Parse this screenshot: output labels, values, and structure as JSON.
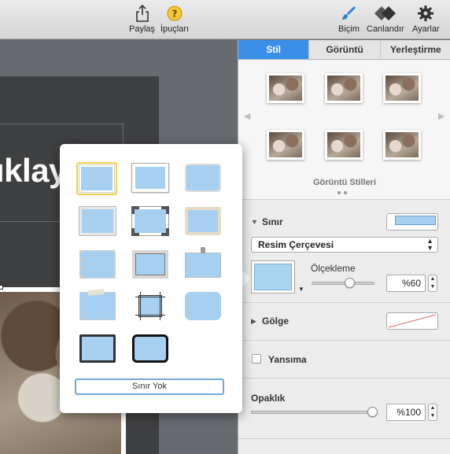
{
  "toolbar": {
    "share_label": "Paylaş",
    "tips_label": "İpuçları",
    "format_label": "Biçim",
    "animate_label": "Canlandır",
    "settings_label": "Ayarlar"
  },
  "slide": {
    "title_fragment": "ıklayın"
  },
  "inspector": {
    "tabs": [
      "Stil",
      "Görüntü",
      "Yerleştirme"
    ],
    "active_tab": "Stil",
    "styles_label": "Görüntü Stilleri",
    "border": {
      "label": "Sınır",
      "type_value": "Resim Çerçevesi",
      "scale_label": "Ölçekleme",
      "scale_value": "%60",
      "scale_fraction": 0.6
    },
    "shadow_label": "Gölge",
    "reflection_label": "Yansıma",
    "opacity": {
      "label": "Opaklık",
      "value": "%100",
      "fraction": 1.0
    }
  },
  "popover": {
    "none_button": "Sınır Yok"
  },
  "colors": {
    "accent": "#3b8fe8",
    "frame_fill": "#a6cff0",
    "selected_outline": "#f0d04a"
  }
}
